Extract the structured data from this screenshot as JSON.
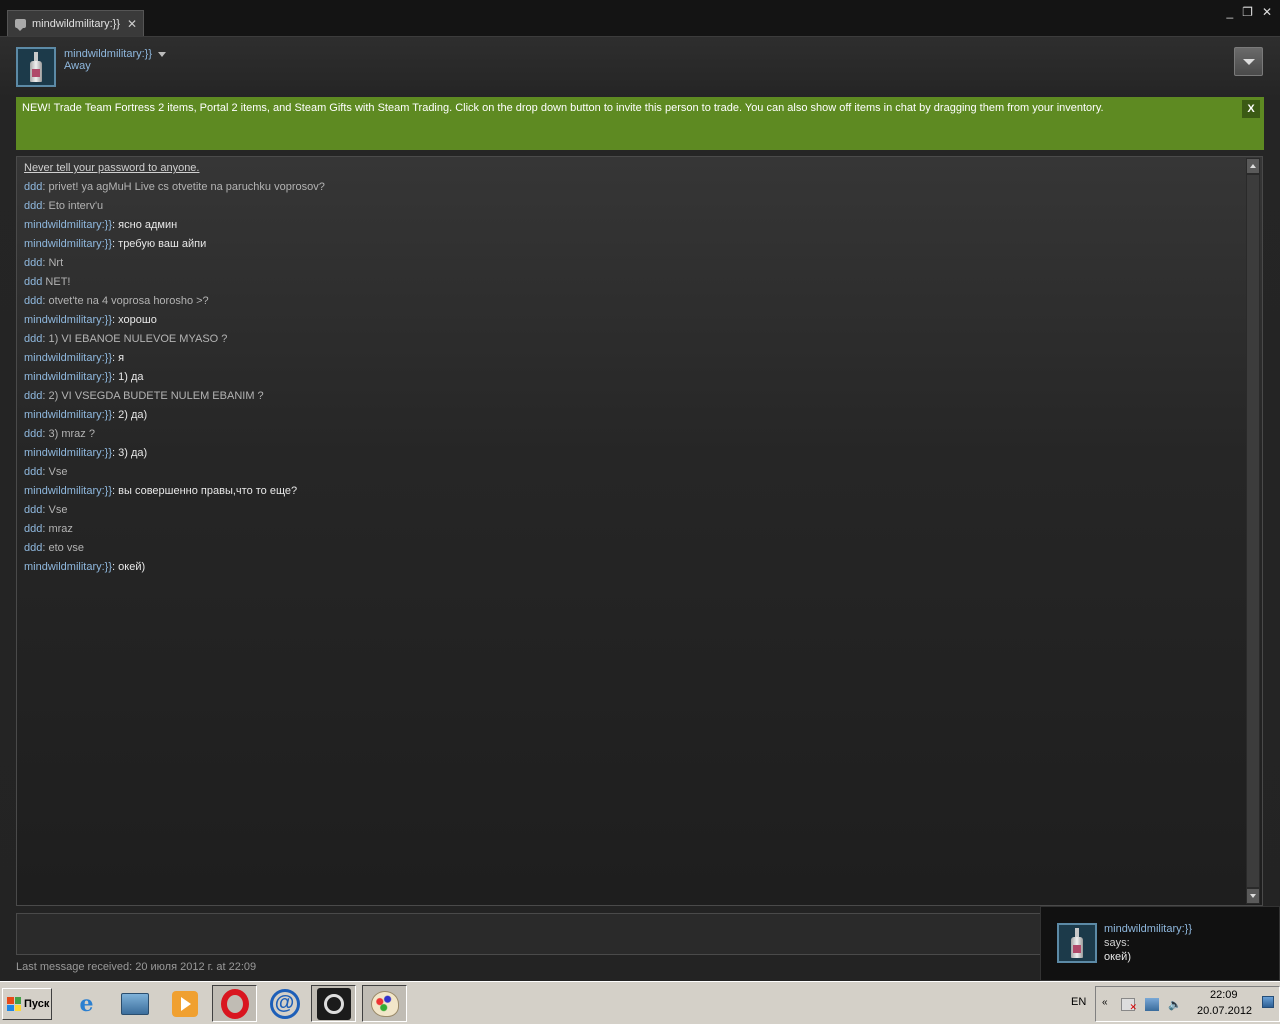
{
  "window": {
    "tab_title": "mindwildmilitary:}}",
    "tab_close": "✕",
    "controls": {
      "minimize": "_",
      "restore": "❐",
      "close": "✕"
    }
  },
  "contact": {
    "name": "mindwildmilitary:}}",
    "status": "Away"
  },
  "banner": {
    "text": "NEW! Trade Team Fortress 2 items, Portal 2 items, and Steam Gifts with Steam Trading. Click on the drop down button to invite this person to trade. You can also show off items in chat by dragging them from your inventory.",
    "close_label": "X",
    "color": "#5e8a22"
  },
  "chat": {
    "warning": "Never tell your password to anyone.",
    "messages": [
      {
        "who": "ddd",
        "sep": ": ",
        "text": "privet! ya agMuH Live cs otvetite na paruchku voprosov?"
      },
      {
        "who": "ddd",
        "sep": ": ",
        "text": "Eto interv'u"
      },
      {
        "who": "mindwildmilitary:}}",
        "sep": ": ",
        "text": "ясно админ"
      },
      {
        "who": "mindwildmilitary:}}",
        "sep": ": ",
        "text": "требую ваш айпи"
      },
      {
        "who": "ddd",
        "sep": ": ",
        "text": "Nrt"
      },
      {
        "who": "ddd",
        "sep": " ",
        "text": "NET!"
      },
      {
        "who": "ddd",
        "sep": ": ",
        "text": "otvet'te na 4 voprosa horosho >?"
      },
      {
        "who": "mindwildmilitary:}}",
        "sep": ": ",
        "text": "хорошо"
      },
      {
        "who": "ddd",
        "sep": ": ",
        "text": "1) VI EBANOE NULEVOE MYASO ?"
      },
      {
        "who": "mindwildmilitary:}}",
        "sep": ": ",
        "text": "я"
      },
      {
        "who": "mindwildmilitary:}}",
        "sep": ": ",
        "text": "1) да"
      },
      {
        "who": "ddd",
        "sep": ": ",
        "text": "2) VI VSEGDA BUDETE NULEM EBANIM ?"
      },
      {
        "who": "mindwildmilitary:}}",
        "sep": ": ",
        "text": "2) да)"
      },
      {
        "who": "ddd",
        "sep": ": ",
        "text": "3) mraz ?"
      },
      {
        "who": "mindwildmilitary:}}",
        "sep": ": ",
        "text": "3) да)"
      },
      {
        "who": "ddd",
        "sep": ": ",
        "text": "Vse"
      },
      {
        "who": "mindwildmilitary:}}",
        "sep": ": ",
        "text": "вы совершенно правы,что то еще?"
      },
      {
        "who": "ddd",
        "sep": ": ",
        "text": "Vse"
      },
      {
        "who": "ddd",
        "sep": ": ",
        "text": "mraz"
      },
      {
        "who": "ddd",
        "sep": ": ",
        "text": "eto vse"
      },
      {
        "who": "mindwildmilitary:}}",
        "sep": ": ",
        "text": "окей)"
      }
    ],
    "last_message": "Last message received: 20 июля 2012 г. at 22:09"
  },
  "toast": {
    "name": "mindwildmilitary:}}",
    "says": "says:",
    "message": "окей)"
  },
  "taskbar": {
    "start_label": "Пуск",
    "apps": [
      "ie-icon",
      "explorer-icon",
      "media-player-icon",
      "opera-icon",
      "mail-agent-icon",
      "steam-icon",
      "paint-icon"
    ],
    "language": "EN",
    "tray_chevron": "«",
    "time": "22:09",
    "date": "20.07.2012"
  }
}
